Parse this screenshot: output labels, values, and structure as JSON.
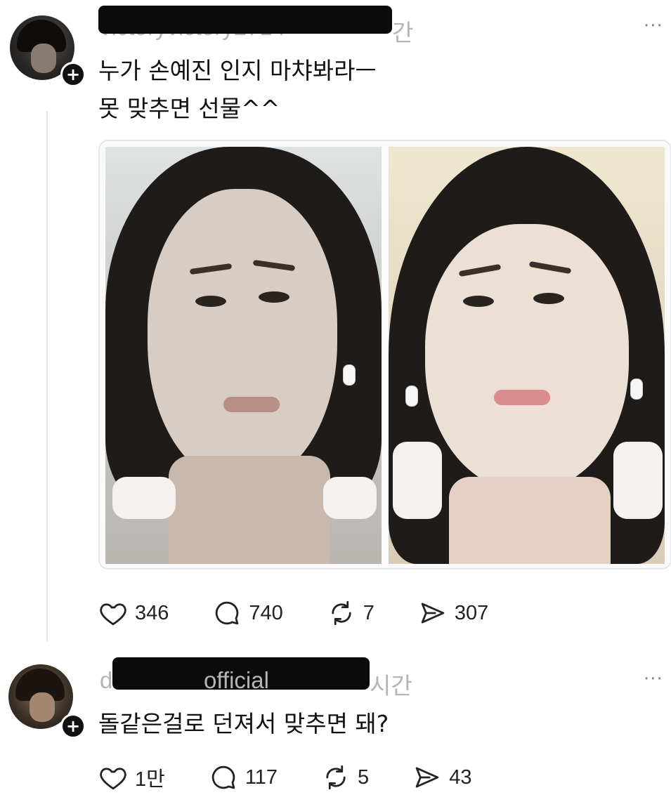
{
  "post1": {
    "username": "victoryvictory2714",
    "time": "간",
    "text_line1": "누가 손예진 인지 마챠봐라ㅡ",
    "text_line2": "못 맞추면 선물^^",
    "more": "···",
    "likes": "346",
    "replies": "740",
    "reposts": "7",
    "shares": "307"
  },
  "post2": {
    "username": "official",
    "username_prefix": "d",
    "time": "시간",
    "text": "돌같은걸로 던져서 맞추면 돼?",
    "more": "···",
    "likes": "1만",
    "replies": "117",
    "reposts": "5",
    "shares": "43"
  },
  "icons": [
    "heart-icon",
    "comment-icon",
    "repost-icon",
    "share-icon",
    "plus-icon"
  ]
}
